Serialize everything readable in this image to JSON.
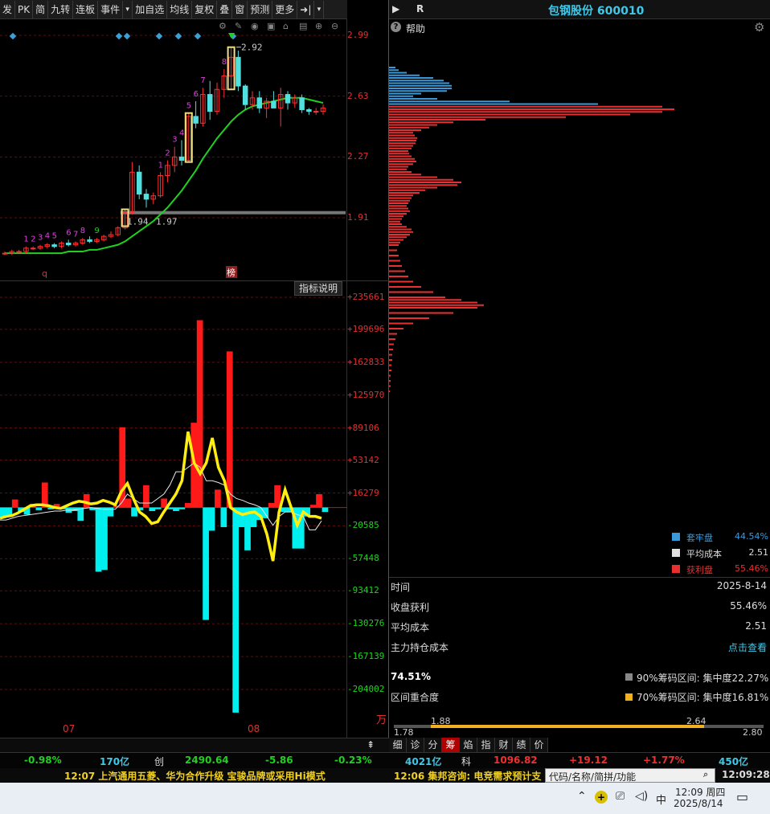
{
  "toolbar": {
    "items": [
      "发",
      "PK",
      "简",
      "九转",
      "连板",
      "事件",
      "▾",
      "加自选",
      "均线",
      "复权",
      "叠",
      "窗",
      "预测",
      "更多",
      "➜|",
      "▾"
    ]
  },
  "right_header": {
    "arrow": "▶",
    "r_label": "R",
    "title": "包钢股份 600010"
  },
  "help": {
    "label": "帮助"
  },
  "kline": {
    "price_axis": [
      "2.99",
      "2.63",
      "2.27",
      "1.91"
    ],
    "high_label": "2.92",
    "low_label_1": "1.94",
    "low_label_2": "1.97",
    "seq_labels": [
      "1",
      "2",
      "3",
      "4",
      "5",
      "6",
      "7",
      "8",
      "9",
      "1",
      "2",
      "3",
      "4",
      "5",
      "6",
      "7",
      "8"
    ],
    "marker_q": "q",
    "marker_bang": "榜",
    "candles": [
      [
        1.7,
        1.71,
        1.69,
        1.7
      ],
      [
        1.7,
        1.72,
        1.69,
        1.71
      ],
      [
        1.71,
        1.72,
        1.7,
        1.71
      ],
      [
        1.71,
        1.74,
        1.7,
        1.73
      ],
      [
        1.73,
        1.74,
        1.72,
        1.73
      ],
      [
        1.73,
        1.75,
        1.72,
        1.74
      ],
      [
        1.74,
        1.76,
        1.73,
        1.75
      ],
      [
        1.75,
        1.76,
        1.73,
        1.74
      ],
      [
        1.74,
        1.77,
        1.73,
        1.76
      ],
      [
        1.76,
        1.78,
        1.74,
        1.75
      ],
      [
        1.75,
        1.77,
        1.74,
        1.76
      ],
      [
        1.76,
        1.79,
        1.75,
        1.78
      ],
      [
        1.78,
        1.8,
        1.76,
        1.77
      ],
      [
        1.77,
        1.79,
        1.76,
        1.78
      ],
      [
        1.78,
        1.81,
        1.77,
        1.8
      ],
      [
        1.8,
        1.83,
        1.79,
        1.81
      ],
      [
        1.81,
        1.86,
        1.8,
        1.85
      ],
      [
        1.85,
        1.96,
        1.84,
        1.94
      ],
      [
        1.94,
        2.24,
        1.93,
        2.18
      ],
      [
        2.18,
        2.22,
        2.02,
        2.05
      ],
      [
        2.05,
        2.08,
        1.97,
        2.02
      ],
      [
        2.02,
        2.06,
        1.99,
        2.04
      ],
      [
        2.04,
        2.18,
        2.03,
        2.16
      ],
      [
        2.16,
        2.25,
        2.12,
        2.22
      ],
      [
        2.22,
        2.33,
        2.18,
        2.27
      ],
      [
        2.27,
        2.37,
        2.22,
        2.25
      ],
      [
        2.25,
        2.53,
        2.24,
        2.51
      ],
      [
        2.51,
        2.6,
        2.44,
        2.47
      ],
      [
        2.47,
        2.68,
        2.45,
        2.64
      ],
      [
        2.64,
        2.72,
        2.49,
        2.54
      ],
      [
        2.54,
        2.71,
        2.52,
        2.67
      ],
      [
        2.67,
        2.79,
        2.62,
        2.75
      ],
      [
        2.75,
        2.92,
        2.67,
        2.86
      ],
      [
        2.86,
        2.9,
        2.66,
        2.69
      ],
      [
        2.69,
        2.7,
        2.55,
        2.58
      ],
      [
        2.58,
        2.66,
        2.55,
        2.62
      ],
      [
        2.62,
        2.66,
        2.53,
        2.56
      ],
      [
        2.56,
        2.62,
        2.5,
        2.6
      ],
      [
        2.6,
        2.66,
        2.56,
        2.56
      ],
      [
        2.56,
        2.68,
        2.45,
        2.64
      ],
      [
        2.64,
        2.66,
        2.55,
        2.59
      ],
      [
        2.59,
        2.64,
        2.56,
        2.62
      ],
      [
        2.62,
        2.64,
        2.53,
        2.55
      ],
      [
        2.55,
        2.56,
        2.52,
        2.54
      ],
      [
        2.54,
        2.56,
        2.52,
        2.54
      ],
      [
        2.54,
        2.58,
        2.52,
        2.56
      ]
    ],
    "ma": [
      1.7,
      1.7,
      1.7,
      1.7,
      1.7,
      1.7,
      1.7,
      1.7,
      1.7,
      1.71,
      1.71,
      1.71,
      1.72,
      1.72,
      1.73,
      1.74,
      1.75,
      1.77,
      1.8,
      1.83,
      1.86,
      1.89,
      1.93,
      1.97,
      2.02,
      2.07,
      2.13,
      2.19,
      2.26,
      2.32,
      2.38,
      2.43,
      2.48,
      2.52,
      2.55,
      2.57,
      2.58,
      2.59,
      2.6,
      2.61,
      2.62,
      2.62,
      2.62,
      2.61,
      2.6,
      2.59
    ]
  },
  "indicator": {
    "button": "指标说明",
    "axis": [
      "+235661",
      "+199696",
      "+162833",
      "+125970",
      "+89106",
      "+53142",
      "+16279",
      "-20585",
      "-57448",
      "-93412",
      "-130276",
      "-167139",
      "-204002"
    ],
    "unit": "万",
    "dates": [
      "07",
      "08"
    ],
    "bars": [
      -12000,
      -10000,
      9000,
      -5000,
      -8000,
      4000,
      -3000,
      28000,
      -2000,
      4000,
      -2000,
      -6000,
      -4000,
      -15000,
      15000,
      -3000,
      -72000,
      -70000,
      -10000,
      2000,
      90000,
      10000,
      -10000,
      -3000,
      25000,
      -4000,
      -2000,
      10000,
      -2000,
      -4000,
      -2000,
      5000,
      95000,
      210000,
      -126000,
      -26000,
      20000,
      -22000,
      175000,
      -230000,
      -22000,
      -48000,
      -22000,
      -14000,
      -12000,
      5000,
      25000,
      -5000,
      -5000,
      -46000,
      -46000,
      -10000,
      3000,
      15000,
      -5000
    ],
    "line_yellow": [
      -12000,
      -10000,
      -9000,
      -6000,
      -2000,
      2000,
      3000,
      3000,
      2000,
      0,
      -1000,
      2000,
      5000,
      7000,
      6000,
      4000,
      5000,
      8000,
      6000,
      3000,
      18000,
      27000,
      10000,
      -5000,
      -10000,
      -18000,
      -16000,
      -5000,
      5000,
      15000,
      30000,
      85000,
      50000,
      38000,
      50000,
      78000,
      45000,
      30000,
      0,
      -5000,
      -8000,
      -6000,
      -5000,
      -10000,
      -30000,
      -60000,
      -5000,
      20000,
      0,
      -20000,
      -5000,
      -10000,
      -10000,
      -12000
    ],
    "line_white": [
      -14000,
      -14000,
      -12000,
      -10000,
      -9000,
      -8000,
      -7000,
      -6000,
      -5000,
      -4000,
      -4000,
      -3000,
      -3000,
      -2000,
      -1000,
      0,
      -1000,
      -2000,
      -2000,
      -2000,
      5000,
      15000,
      10000,
      5000,
      5000,
      5000,
      10000,
      15000,
      25000,
      40000,
      40000,
      45000,
      50000,
      45000,
      30000,
      30000,
      28000,
      25000,
      15000,
      10000,
      8000,
      5000,
      3000,
      0,
      -10000,
      -20000,
      -10000,
      -5000,
      -5000,
      -8000,
      -10000,
      -25000,
      -25000,
      -15000
    ]
  },
  "chips": {
    "profile": {
      "rows": [
        [
          0.06,
          8
        ],
        [
          0.065,
          12
        ],
        [
          0.07,
          22
        ],
        [
          0.075,
          38
        ],
        [
          0.08,
          55
        ],
        [
          0.085,
          68
        ],
        [
          0.09,
          75
        ],
        [
          0.095,
          78
        ],
        [
          0.1,
          78
        ],
        [
          0.105,
          72
        ],
        [
          0.11,
          40
        ],
        [
          0.115,
          30
        ],
        [
          0.12,
          60
        ],
        [
          0.125,
          150
        ],
        [
          0.13,
          260
        ],
        [
          0.135,
          340
        ],
        [
          0.14,
          355
        ],
        [
          0.145,
          340
        ],
        [
          0.15,
          300
        ],
        [
          0.155,
          220
        ],
        [
          0.16,
          120
        ],
        [
          0.165,
          80
        ],
        [
          0.17,
          60
        ],
        [
          0.175,
          50
        ],
        [
          0.18,
          40
        ],
        [
          0.185,
          30
        ],
        [
          0.19,
          32
        ],
        [
          0.195,
          35
        ],
        [
          0.2,
          34
        ],
        [
          0.205,
          33
        ],
        [
          0.21,
          30
        ],
        [
          0.215,
          28
        ],
        [
          0.22,
          24
        ],
        [
          0.225,
          25
        ],
        [
          0.23,
          28
        ],
        [
          0.235,
          32
        ],
        [
          0.24,
          34
        ],
        [
          0.245,
          30
        ],
        [
          0.25,
          24
        ],
        [
          0.255,
          22
        ],
        [
          0.26,
          28
        ],
        [
          0.265,
          40
        ],
        [
          0.27,
          60
        ],
        [
          0.275,
          80
        ],
        [
          0.28,
          90
        ],
        [
          0.285,
          85
        ],
        [
          0.29,
          60
        ],
        [
          0.295,
          45
        ],
        [
          0.3,
          38
        ],
        [
          0.305,
          30
        ],
        [
          0.31,
          28
        ],
        [
          0.315,
          26
        ],
        [
          0.32,
          24
        ],
        [
          0.325,
          22
        ],
        [
          0.33,
          24
        ],
        [
          0.335,
          26
        ],
        [
          0.34,
          22
        ],
        [
          0.345,
          18
        ],
        [
          0.35,
          16
        ],
        [
          0.355,
          14
        ],
        [
          0.36,
          16
        ],
        [
          0.365,
          22
        ],
        [
          0.37,
          28
        ],
        [
          0.375,
          30
        ],
        [
          0.38,
          26
        ],
        [
          0.385,
          22
        ],
        [
          0.39,
          18
        ],
        [
          0.395,
          14
        ],
        [
          0.4,
          12
        ],
        [
          0.41,
          10
        ],
        [
          0.42,
          12
        ],
        [
          0.43,
          14
        ],
        [
          0.44,
          16
        ],
        [
          0.45,
          20
        ],
        [
          0.46,
          24
        ],
        [
          0.47,
          30
        ],
        [
          0.48,
          40
        ],
        [
          0.49,
          55
        ],
        [
          0.5,
          70
        ],
        [
          0.505,
          90
        ],
        [
          0.51,
          110
        ],
        [
          0.515,
          118
        ],
        [
          0.52,
          110
        ],
        [
          0.53,
          80
        ],
        [
          0.54,
          50
        ],
        [
          0.55,
          30
        ],
        [
          0.56,
          18
        ],
        [
          0.57,
          10
        ],
        [
          0.58,
          8
        ],
        [
          0.59,
          6
        ],
        [
          0.6,
          5
        ],
        [
          0.61,
          4
        ],
        [
          0.62,
          4
        ],
        [
          0.63,
          3
        ],
        [
          0.64,
          3
        ],
        [
          0.65,
          2
        ],
        [
          0.66,
          2
        ],
        [
          0.67,
          2
        ],
        [
          0.68,
          1
        ]
      ],
      "split": 0.135
    },
    "legend": [
      {
        "label": "套牢盘",
        "value": "44.54%",
        "color": "#3a9ad9"
      },
      {
        "label": "平均成本",
        "value": "2.51",
        "color": "#e0e0e0"
      },
      {
        "label": "获利盘",
        "value": "55.46%",
        "color": "#e83030"
      }
    ],
    "time_label": "时间",
    "time_value": "2025-8-14",
    "profit_label": "收盘获利",
    "profit_value": "55.46%",
    "avg_label": "平均成本",
    "avg_value": "2.51",
    "main_label": "主力持仓成本",
    "main_value": "点击查看",
    "overlap_pct": "74.51%",
    "overlap_label": "区间重合度",
    "range90": "90%筹码区间: 集中度22.27%",
    "range70": "70%筹码区间: 集中度16.81%",
    "bar_low": "1.78",
    "bar_mid_left": "1.88",
    "bar_mid_right": "2.64",
    "bar_high": "2.80"
  },
  "bottom_tabs": [
    "细",
    "诊",
    "分",
    "筹",
    "焰",
    "指",
    "财",
    "绩",
    "价"
  ],
  "statusbar": {
    "s1": "-0.98%",
    "s2": "170亿",
    "s3": "创",
    "s4": "2490.64",
    "s5": "-5.86",
    "s6": "-0.23%",
    "s7": "4021亿",
    "s8": "科",
    "s9": "1096.82",
    "s10": "+19.12",
    "s11": "+1.77%",
    "s12": "450亿"
  },
  "news": {
    "n1": "12:07 上汽通用五菱、华为合作升级 宝骏品牌或采用Hi模式",
    "n2": "12:06 集邦咨询: 电竞需求预计支",
    "search_placeholder": "代码/名称/简拼/功能",
    "clock": "12:09:28"
  },
  "taskbar": {
    "ime": "中",
    "time": "12:09 周四",
    "date": "2025/8/14"
  }
}
